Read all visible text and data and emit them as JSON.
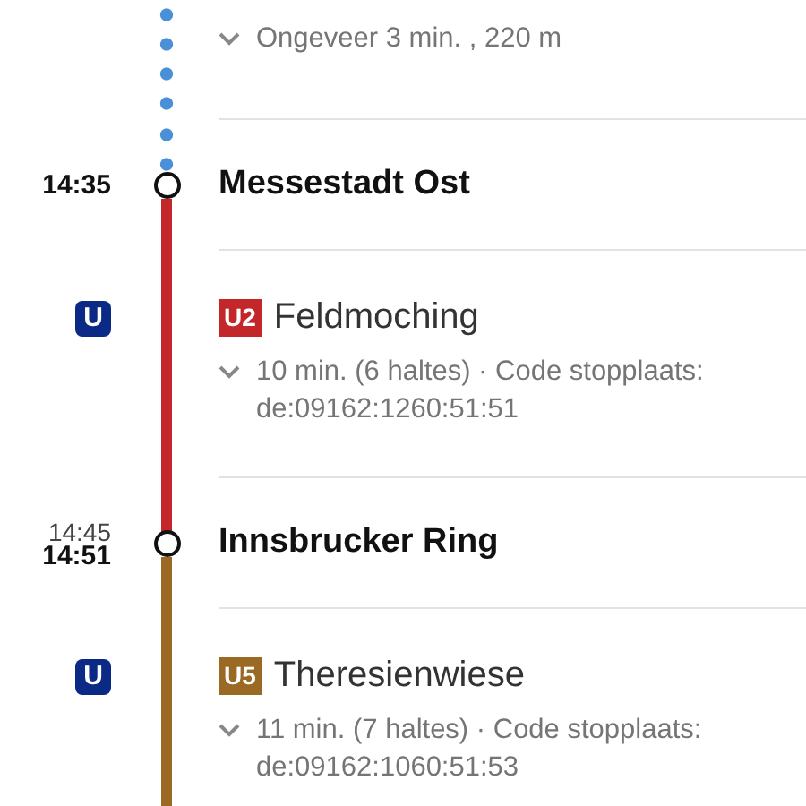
{
  "legs": [
    {
      "kind": "walk",
      "detail": "Ongeveer 3 min. , 220 m"
    },
    {
      "kind": "stop",
      "times": [
        "14:35"
      ],
      "name": "Messestadt Ost"
    },
    {
      "kind": "ride",
      "color": "#c4272a",
      "mode_icon": "U",
      "line": "U2",
      "headsign": "Feldmoching",
      "detail": "10 min. (6 haltes) · Code stopplaats: de:09162:1260:51:51"
    },
    {
      "kind": "stop",
      "times": [
        "14:45",
        "14:51"
      ],
      "name": "Innsbrucker Ring"
    },
    {
      "kind": "ride",
      "color": "#9a6a24",
      "mode_icon": "U",
      "line": "U5",
      "headsign": "Theresienwiese",
      "detail": "11 min. (7 haltes) · Code stopplaats: de:09162:1060:51:53"
    }
  ]
}
